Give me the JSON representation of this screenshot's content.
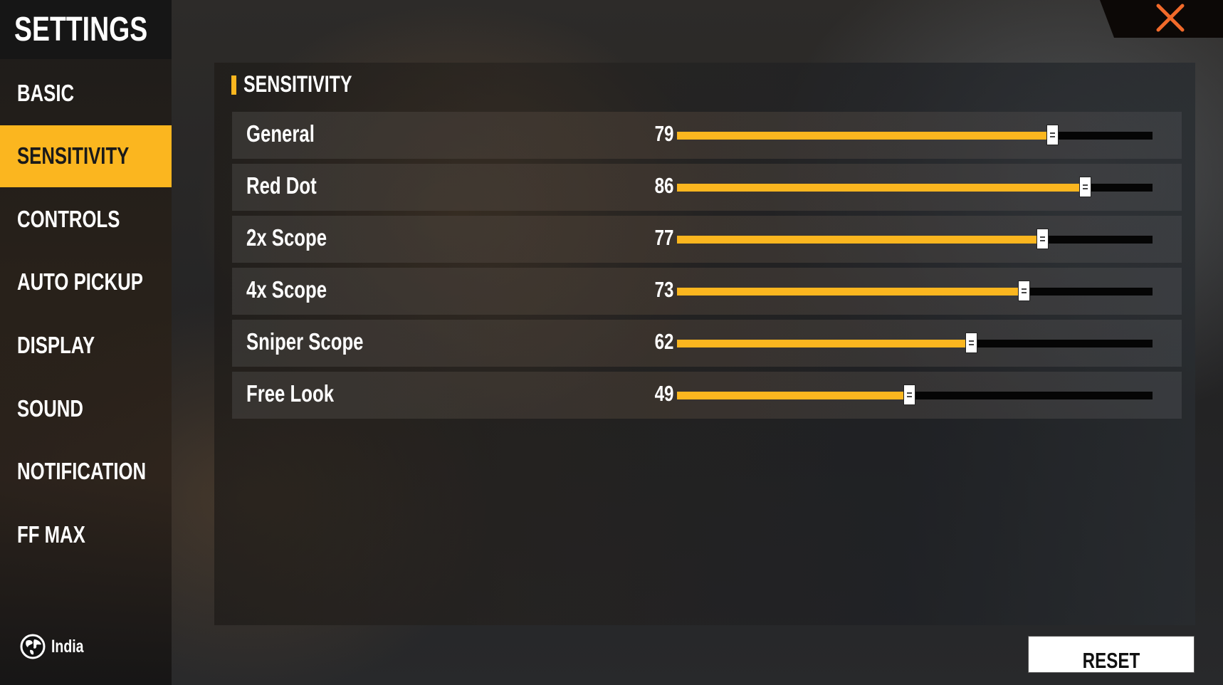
{
  "sidebar": {
    "title": "SETTINGS",
    "items": [
      {
        "label": "BASIC",
        "active": false
      },
      {
        "label": "SENSITIVITY",
        "active": true
      },
      {
        "label": "CONTROLS",
        "active": false
      },
      {
        "label": "AUTO PICKUP",
        "active": false
      },
      {
        "label": "DISPLAY",
        "active": false
      },
      {
        "label": "SOUND",
        "active": false
      },
      {
        "label": "NOTIFICATION",
        "active": false
      },
      {
        "label": "FF MAX",
        "active": false
      }
    ],
    "region": {
      "icon": "globe-icon",
      "label": "India"
    }
  },
  "close_button": {
    "icon": "close-icon",
    "color": "#f26a2a"
  },
  "panel": {
    "section_title": "SENSITIVITY",
    "slider_range": [
      0,
      100
    ],
    "sliders": [
      {
        "label": "General",
        "value": 79
      },
      {
        "label": "Red Dot",
        "value": 86
      },
      {
        "label": "2x Scope",
        "value": 77
      },
      {
        "label": "4x Scope",
        "value": 73
      },
      {
        "label": "Sniper Scope",
        "value": 62
      },
      {
        "label": "Free Look",
        "value": 49
      }
    ]
  },
  "reset_button": {
    "label": "RESET"
  },
  "colors": {
    "accent": "#fbb61f",
    "track": "#050505",
    "text": "#ffffff"
  }
}
